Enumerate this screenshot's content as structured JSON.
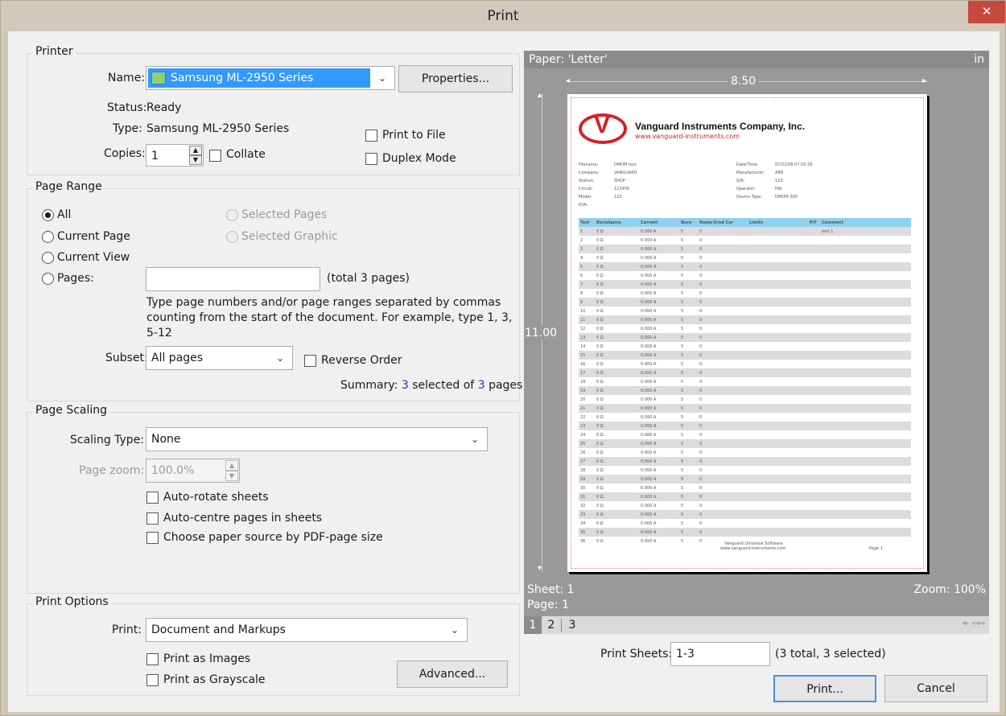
{
  "window": {
    "title": "Print",
    "close_glyph": "✕"
  },
  "printer": {
    "legend": "Printer",
    "name_label": "Name:",
    "name_value": "Samsung ML-2950 Series",
    "properties_label": "Properties...",
    "status_label": "Status:",
    "status_value": "Ready",
    "type_label": "Type:",
    "type_value": "Samsung ML-2950 Series",
    "copies_label": "Copies:",
    "copies_value": "1",
    "collate_label": "Collate",
    "print_to_file_label": "Print to File",
    "duplex_label": "Duplex Mode"
  },
  "page_range": {
    "legend": "Page Range",
    "all_label": "All",
    "current_page_label": "Current Page",
    "current_view_label": "Current View",
    "pages_label": "Pages:",
    "selected_pages_label": "Selected Pages",
    "selected_graphic_label": "Selected Graphic",
    "total_text": "(total 3 pages)",
    "help_line1": "Type page numbers and/or page ranges separated by commas",
    "help_line2": "counting from the start of the document. For example, type 1, 3,",
    "help_line3": "5-12",
    "subset_label": "Subset:",
    "subset_value": "All pages",
    "reverse_label": "Reverse Order",
    "summary_prefix": "Summary:",
    "summary_selected": "3",
    "summary_mid": "selected of",
    "summary_total": "3",
    "summary_suffix": "pages"
  },
  "page_scaling": {
    "legend": "Page Scaling",
    "scaling_type_label": "Scaling Type:",
    "scaling_type_value": "None",
    "page_zoom_label": "Page zoom:",
    "page_zoom_value": "100.0%",
    "auto_rotate_label": "Auto-rotate sheets",
    "auto_centre_label": "Auto-centre pages in sheets",
    "paper_source_label": "Choose paper source by PDF-page size"
  },
  "print_options": {
    "legend": "Print Options",
    "print_label": "Print:",
    "print_value": "Document and Markups",
    "as_images_label": "Print as Images",
    "as_grayscale_label": "Print as Grayscale",
    "advanced_label": "Advanced..."
  },
  "preview": {
    "paper_label": "Paper: 'Letter'",
    "units": "in",
    "width_label": "8.50",
    "height_label": "11.00",
    "sheet_label": "Sheet: 1",
    "page_label": "Page: 1",
    "zoom_label": "Zoom: 100%",
    "tabs": [
      "1",
      "2",
      "3"
    ],
    "nav_glyphs": "◂▸ ◂◂▸▸",
    "doc": {
      "company": "Vanguard Instruments Company, Inc.",
      "website": "www.vanguard-instruments.com",
      "left_fields": [
        {
          "k": "Filename:",
          "v": "DMOM test"
        },
        {
          "k": "Company:",
          "v": "VANGUARD"
        },
        {
          "k": "Station:",
          "v": "SHOP"
        },
        {
          "k": "Circuit:",
          "v": "123456"
        },
        {
          "k": "Model:",
          "v": "123"
        },
        {
          "k": "KVA:",
          "v": ""
        }
      ],
      "right_fields": [
        {
          "k": "Date/Time:",
          "v": "07/22/08 07:50:26"
        },
        {
          "k": "Manufacturer:",
          "v": "ABB"
        },
        {
          "k": "S/N:",
          "v": "123"
        },
        {
          "k": "Operator:",
          "v": "HAI"
        },
        {
          "k": "Device Type:",
          "v": "DMOM-200"
        }
      ],
      "table_headers": [
        "Test",
        "Resistance",
        "Current",
        "Burn",
        "Ramp",
        "Grnd Cur",
        "Limits",
        "P/F",
        "Comment"
      ],
      "row_template": {
        "resistance": "0 Ω",
        "current": "0.000 A",
        "burn": "5",
        "ramp": "0"
      },
      "first_comment": "test 1",
      "row_count": 36,
      "footer_line1": "Vanguard Universal Software",
      "footer_line2": "www.vanguard-instruments.com",
      "footer_page": "Page 1"
    }
  },
  "bottom": {
    "print_sheets_label": "Print Sheets:",
    "print_sheets_value": "1-3",
    "sheets_summary": "(3 total, 3 selected)",
    "print_button": "Print...",
    "cancel_button": "Cancel"
  },
  "colors": {
    "accent": "#3399ff",
    "table_header": "#8fd0ef",
    "logo_red": "#d32027",
    "link_blue": "#1a3fa8"
  }
}
